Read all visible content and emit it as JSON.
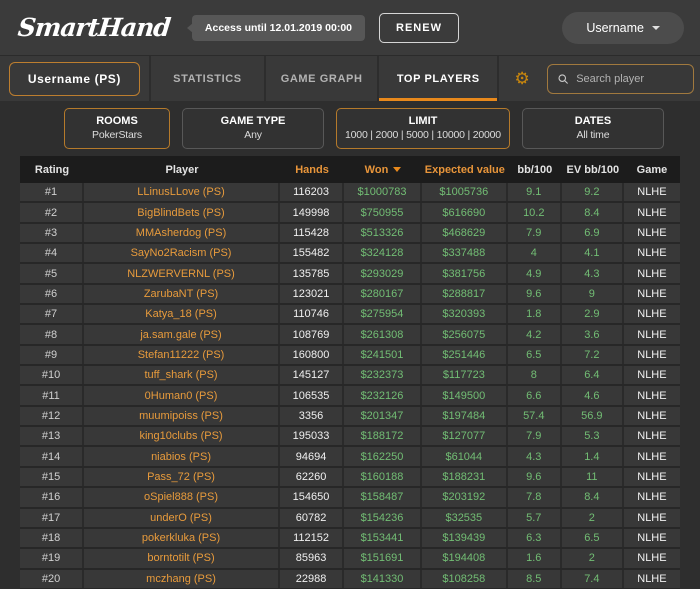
{
  "colors": {
    "accent": "#e8891c",
    "orange-text": "#e89b3c",
    "positive": "#72bd74"
  },
  "header": {
    "logo": "SmartHand",
    "access_badge": "Access until 12.01.2019 00:00",
    "renew_label": "RENEW",
    "user_menu_label": "Username"
  },
  "nav": {
    "tabs": [
      {
        "label": "Username (PS)",
        "active": false
      },
      {
        "label": "STATISTICS",
        "active": false
      },
      {
        "label": "GAME GRAPH",
        "active": false
      },
      {
        "label": "TOP PLAYERS",
        "active": true
      }
    ],
    "search_placeholder": "Search player"
  },
  "icons": {
    "gear": "⚙"
  },
  "filters": [
    {
      "title": "ROOMS",
      "value": "PokerStars",
      "highlighted": true
    },
    {
      "title": "GAME TYPE",
      "value": "Any",
      "highlighted": false
    },
    {
      "title": "LIMIT",
      "value": "1000 | 2000 | 5000 | 10000 | 20000",
      "highlighted": true
    },
    {
      "title": "DATES",
      "value": "All time",
      "highlighted": false
    }
  ],
  "table": {
    "columns": [
      "Rating",
      "Player",
      "Hands",
      "Won",
      "Expected value",
      "bb/100",
      "EV bb/100",
      "Game"
    ],
    "sort": {
      "column": "Won",
      "direction": "desc"
    },
    "rows": [
      {
        "rating": "#1",
        "player": "LLinusLLove (PS)",
        "hands": "116203",
        "won": "$1000783",
        "expected_value": "$1005736",
        "bb100": "9.1",
        "ev_bb100": "9.2",
        "game": "NLHE"
      },
      {
        "rating": "#2",
        "player": "BigBlindBets (PS)",
        "hands": "149998",
        "won": "$750955",
        "expected_value": "$616690",
        "bb100": "10.2",
        "ev_bb100": "8.4",
        "game": "NLHE"
      },
      {
        "rating": "#3",
        "player": "MMAsherdog (PS)",
        "hands": "115428",
        "won": "$513326",
        "expected_value": "$468629",
        "bb100": "7.9",
        "ev_bb100": "6.9",
        "game": "NLHE"
      },
      {
        "rating": "#4",
        "player": "SayNo2Racism (PS)",
        "hands": "155482",
        "won": "$324128",
        "expected_value": "$337488",
        "bb100": "4",
        "ev_bb100": "4.1",
        "game": "NLHE"
      },
      {
        "rating": "#5",
        "player": "NLZWERVERNL (PS)",
        "hands": "135785",
        "won": "$293029",
        "expected_value": "$381756",
        "bb100": "4.9",
        "ev_bb100": "4.3",
        "game": "NLHE"
      },
      {
        "rating": "#6",
        "player": "ZarubaNT (PS)",
        "hands": "123021",
        "won": "$280167",
        "expected_value": "$288817",
        "bb100": "9.6",
        "ev_bb100": "9",
        "game": "NLHE"
      },
      {
        "rating": "#7",
        "player": "Katya_18 (PS)",
        "hands": "110746",
        "won": "$275954",
        "expected_value": "$320393",
        "bb100": "1.8",
        "ev_bb100": "2.9",
        "game": "NLHE"
      },
      {
        "rating": "#8",
        "player": "ja.sam.gale (PS)",
        "hands": "108769",
        "won": "$261308",
        "expected_value": "$256075",
        "bb100": "4.2",
        "ev_bb100": "3.6",
        "game": "NLHE"
      },
      {
        "rating": "#9",
        "player": "Stefan11222 (PS)",
        "hands": "160800",
        "won": "$241501",
        "expected_value": "$251446",
        "bb100": "6.5",
        "ev_bb100": "7.2",
        "game": "NLHE"
      },
      {
        "rating": "#10",
        "player": "tuff_shark (PS)",
        "hands": "145127",
        "won": "$232373",
        "expected_value": "$117723",
        "bb100": "8",
        "ev_bb100": "6.4",
        "game": "NLHE"
      },
      {
        "rating": "#11",
        "player": "0Human0 (PS)",
        "hands": "106535",
        "won": "$232126",
        "expected_value": "$149500",
        "bb100": "6.6",
        "ev_bb100": "4.6",
        "game": "NLHE"
      },
      {
        "rating": "#12",
        "player": "muumipoiss (PS)",
        "hands": "3356",
        "won": "$201347",
        "expected_value": "$197484",
        "bb100": "57.4",
        "ev_bb100": "56.9",
        "game": "NLHE"
      },
      {
        "rating": "#13",
        "player": "king10clubs (PS)",
        "hands": "195033",
        "won": "$188172",
        "expected_value": "$127077",
        "bb100": "7.9",
        "ev_bb100": "5.3",
        "game": "NLHE"
      },
      {
        "rating": "#14",
        "player": "niabios (PS)",
        "hands": "94694",
        "won": "$162250",
        "expected_value": "$61044",
        "bb100": "4.3",
        "ev_bb100": "1.4",
        "game": "NLHE"
      },
      {
        "rating": "#15",
        "player": "Pass_72 (PS)",
        "hands": "62260",
        "won": "$160188",
        "expected_value": "$188231",
        "bb100": "9.6",
        "ev_bb100": "11",
        "game": "NLHE"
      },
      {
        "rating": "#16",
        "player": "oSpiel888 (PS)",
        "hands": "154650",
        "won": "$158487",
        "expected_value": "$203192",
        "bb100": "7.8",
        "ev_bb100": "8.4",
        "game": "NLHE"
      },
      {
        "rating": "#17",
        "player": "underO (PS)",
        "hands": "60782",
        "won": "$154236",
        "expected_value": "$32535",
        "bb100": "5.7",
        "ev_bb100": "2",
        "game": "NLHE"
      },
      {
        "rating": "#18",
        "player": "pokerkluka (PS)",
        "hands": "112152",
        "won": "$153441",
        "expected_value": "$139439",
        "bb100": "6.3",
        "ev_bb100": "6.5",
        "game": "NLHE"
      },
      {
        "rating": "#19",
        "player": "borntotilt (PS)",
        "hands": "85963",
        "won": "$151691",
        "expected_value": "$194408",
        "bb100": "1.6",
        "ev_bb100": "2",
        "game": "NLHE"
      },
      {
        "rating": "#20",
        "player": "mczhang (PS)",
        "hands": "22988",
        "won": "$141330",
        "expected_value": "$108258",
        "bb100": "8.5",
        "ev_bb100": "7.4",
        "game": "NLHE"
      }
    ]
  }
}
